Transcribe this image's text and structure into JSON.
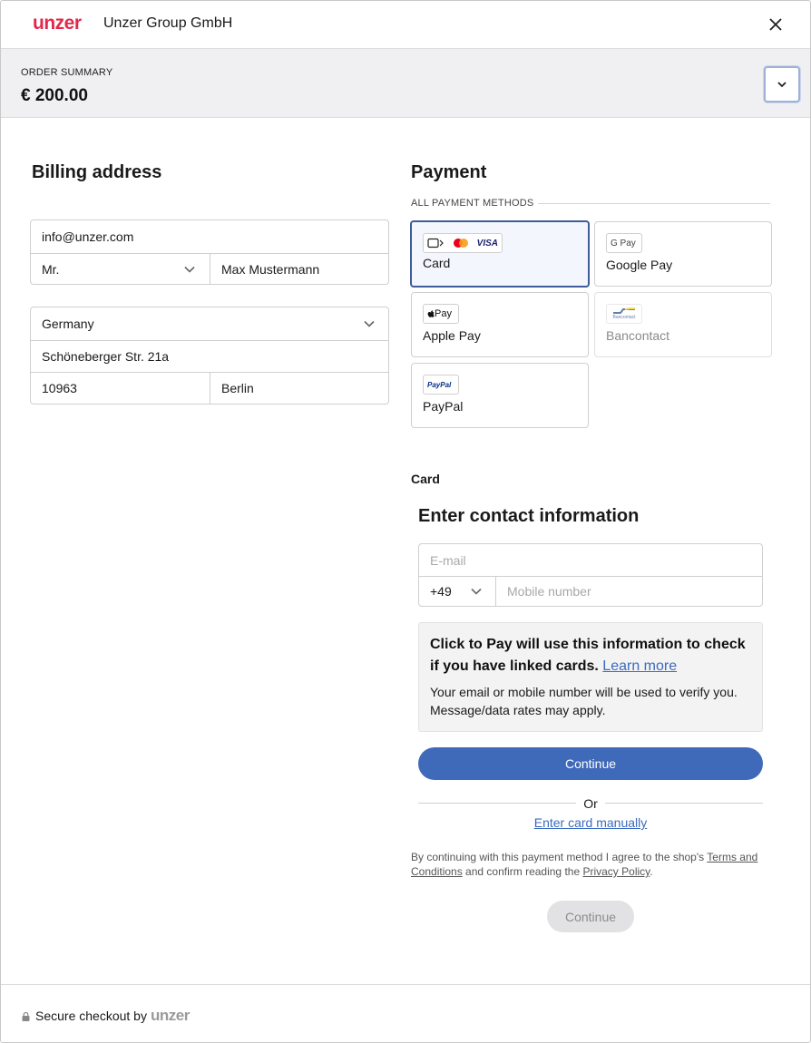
{
  "header": {
    "logo": "unzer",
    "merchant": "Unzer Group GmbH",
    "close_icon": "close-icon"
  },
  "summary": {
    "label": "ORDER SUMMARY",
    "amount": "€ 200.00",
    "toggle_icon": "chevron-down-icon"
  },
  "billing": {
    "title": "Billing address",
    "email": "info@unzer.com",
    "salutation": "Mr.",
    "name": "Max Mustermann",
    "country": "Germany",
    "street": "Schöneberger Str. 21a",
    "zip": "10963",
    "city": "Berlin"
  },
  "payment": {
    "title": "Payment",
    "methods_label": "ALL PAYMENT METHODS",
    "methods": [
      {
        "name": "Card",
        "selected": true,
        "disabled": false
      },
      {
        "name": "Google Pay",
        "selected": false,
        "disabled": false,
        "badge": "G Pay"
      },
      {
        "name": "Apple Pay",
        "selected": false,
        "disabled": false,
        "badge": "Pay"
      },
      {
        "name": "Bancontact",
        "selected": false,
        "disabled": true,
        "badge": "Bancontact"
      },
      {
        "name": "PayPal",
        "selected": false,
        "disabled": false,
        "badge": "PayPal"
      }
    ],
    "card_badge": {
      "visa": "VISA"
    }
  },
  "card": {
    "section_label": "Card",
    "contact_title": "Enter contact information",
    "email_placeholder": "E-mail",
    "country_code": "+49",
    "mobile_placeholder": "Mobile number",
    "info_strong": "Click to Pay will use this information to check if you have linked cards.",
    "learn_more": "Learn more",
    "info_small": "Your email or mobile number will be used to verify you. Message/data rates may apply.",
    "continue_label": "Continue",
    "or_label": "Or",
    "manual_link": "Enter card manually"
  },
  "terms": {
    "prefix": "By continuing with this payment method I agree to the shop's",
    "terms_link": "Terms and Conditions",
    "middle": "and confirm reading the",
    "privacy_link": "Privacy Policy",
    "suffix": "."
  },
  "final_button": "Continue",
  "footer": {
    "text": "Secure checkout by",
    "logo": "unzer"
  },
  "colors": {
    "brand": "#e2284a",
    "primary_button": "#3f69b9",
    "link": "#3b6bbf",
    "selected_border": "#3e5c9a"
  }
}
